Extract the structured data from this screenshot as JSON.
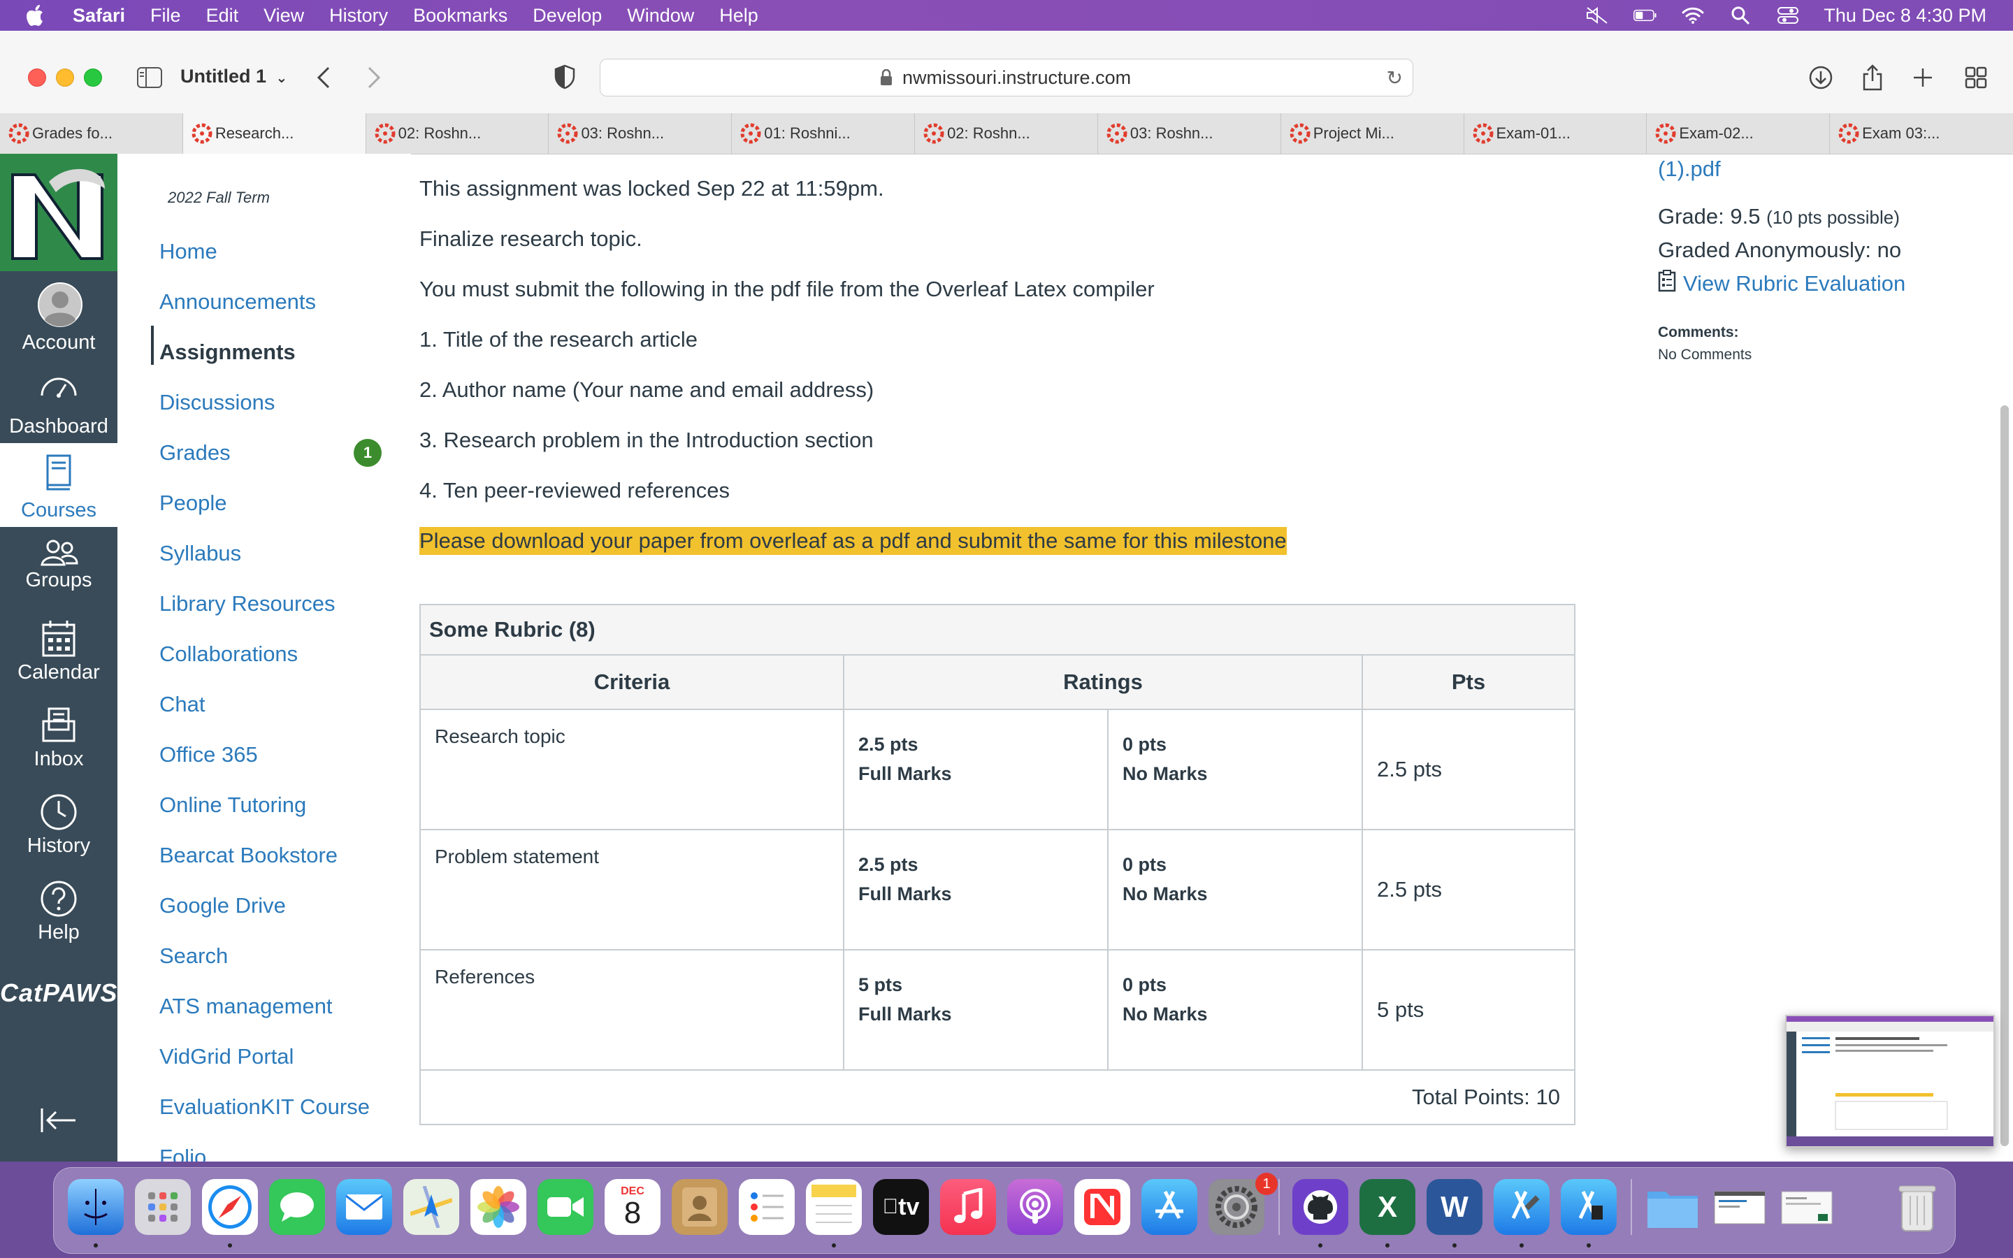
{
  "menubar": {
    "app": "Safari",
    "items": [
      "File",
      "Edit",
      "View",
      "History",
      "Bookmarks",
      "Develop",
      "Window",
      "Help"
    ],
    "clock": "Thu Dec 8  4:30 PM"
  },
  "toolbar": {
    "tab_group_title": "Untitled 1",
    "url": "nwmissouri.instructure.com"
  },
  "tabs": [
    {
      "label": "Grades fo..."
    },
    {
      "label": "Research..."
    },
    {
      "label": "02: Roshn..."
    },
    {
      "label": "03: Roshn..."
    },
    {
      "label": "01: Roshni..."
    },
    {
      "label": "02: Roshn..."
    },
    {
      "label": "03: Roshn..."
    },
    {
      "label": "Project Mi..."
    },
    {
      "label": "Exam-01..."
    },
    {
      "label": "Exam-02..."
    },
    {
      "label": "Exam 03:..."
    }
  ],
  "global_nav": {
    "account": "Account",
    "dashboard": "Dashboard",
    "courses": "Courses",
    "groups": "Groups",
    "calendar": "Calendar",
    "inbox": "Inbox",
    "history": "History",
    "help": "Help",
    "catpaws": "CatPAWS"
  },
  "course_nav": {
    "term": "2022 Fall Term",
    "items": [
      "Home",
      "Announcements",
      "Assignments",
      "Discussions",
      "Grades",
      "People",
      "Syllabus",
      "Library Resources",
      "Collaborations",
      "Chat",
      "Office 365",
      "Online Tutoring",
      "Bearcat Bookstore",
      "Google Drive",
      "Search",
      "ATS management",
      "VidGrid Portal",
      "EvaluationKIT Course",
      "Folio"
    ],
    "grades_badge": "1"
  },
  "assignment": {
    "locked_note": "This assignment was locked Sep 22 at 11:59pm.",
    "line1": "Finalize research topic.",
    "line2": "You must submit the following in the pdf file from the Overleaf Latex compiler",
    "req1": "1. Title of the research article",
    "req2": "2. Author name (Your name and email address)",
    "req3": "3. Research problem in the Introduction section",
    "req4": "4. Ten peer-reviewed references",
    "highlight": "Please download your paper from overleaf as a pdf and submit the same for this milestone"
  },
  "rubric": {
    "title": "Some Rubric (8)",
    "headers": {
      "criteria": "Criteria",
      "ratings": "Ratings",
      "pts": "Pts"
    },
    "rows": [
      {
        "criteria": "Research topic",
        "r1_pts": "2.5 pts",
        "r1_label": "Full Marks",
        "r2_pts": "0 pts",
        "r2_label": "No Marks",
        "pts": "2.5 pts"
      },
      {
        "criteria": "Problem statement",
        "r1_pts": "2.5 pts",
        "r1_label": "Full Marks",
        "r2_pts": "0 pts",
        "r2_label": "No Marks",
        "pts": "2.5 pts"
      },
      {
        "criteria": "References",
        "r1_pts": "5 pts",
        "r1_label": "Full Marks",
        "r2_pts": "0 pts",
        "r2_label": "No Marks",
        "pts": "5 pts"
      }
    ],
    "total": "Total Points: 10"
  },
  "sidebar_right": {
    "pdf_link": "(1).pdf",
    "grade_label": "Grade: 9.5",
    "grade_possible": "(10 pts possible)",
    "anonymous": "Graded Anonymously: no",
    "rubric_link": "View Rubric Evaluation",
    "comments_label": "Comments:",
    "comments_value": "No Comments"
  },
  "dock": {
    "calendar_month": "DEC",
    "calendar_day": "8",
    "tv_label": "tv",
    "settings_badge": "1"
  },
  "colors": {
    "menubar": "#7a49b8",
    "canvas_nav": "#394b58",
    "link": "#2b7abc",
    "highlight": "#f2c12e",
    "badge": "#3c8c2d"
  }
}
